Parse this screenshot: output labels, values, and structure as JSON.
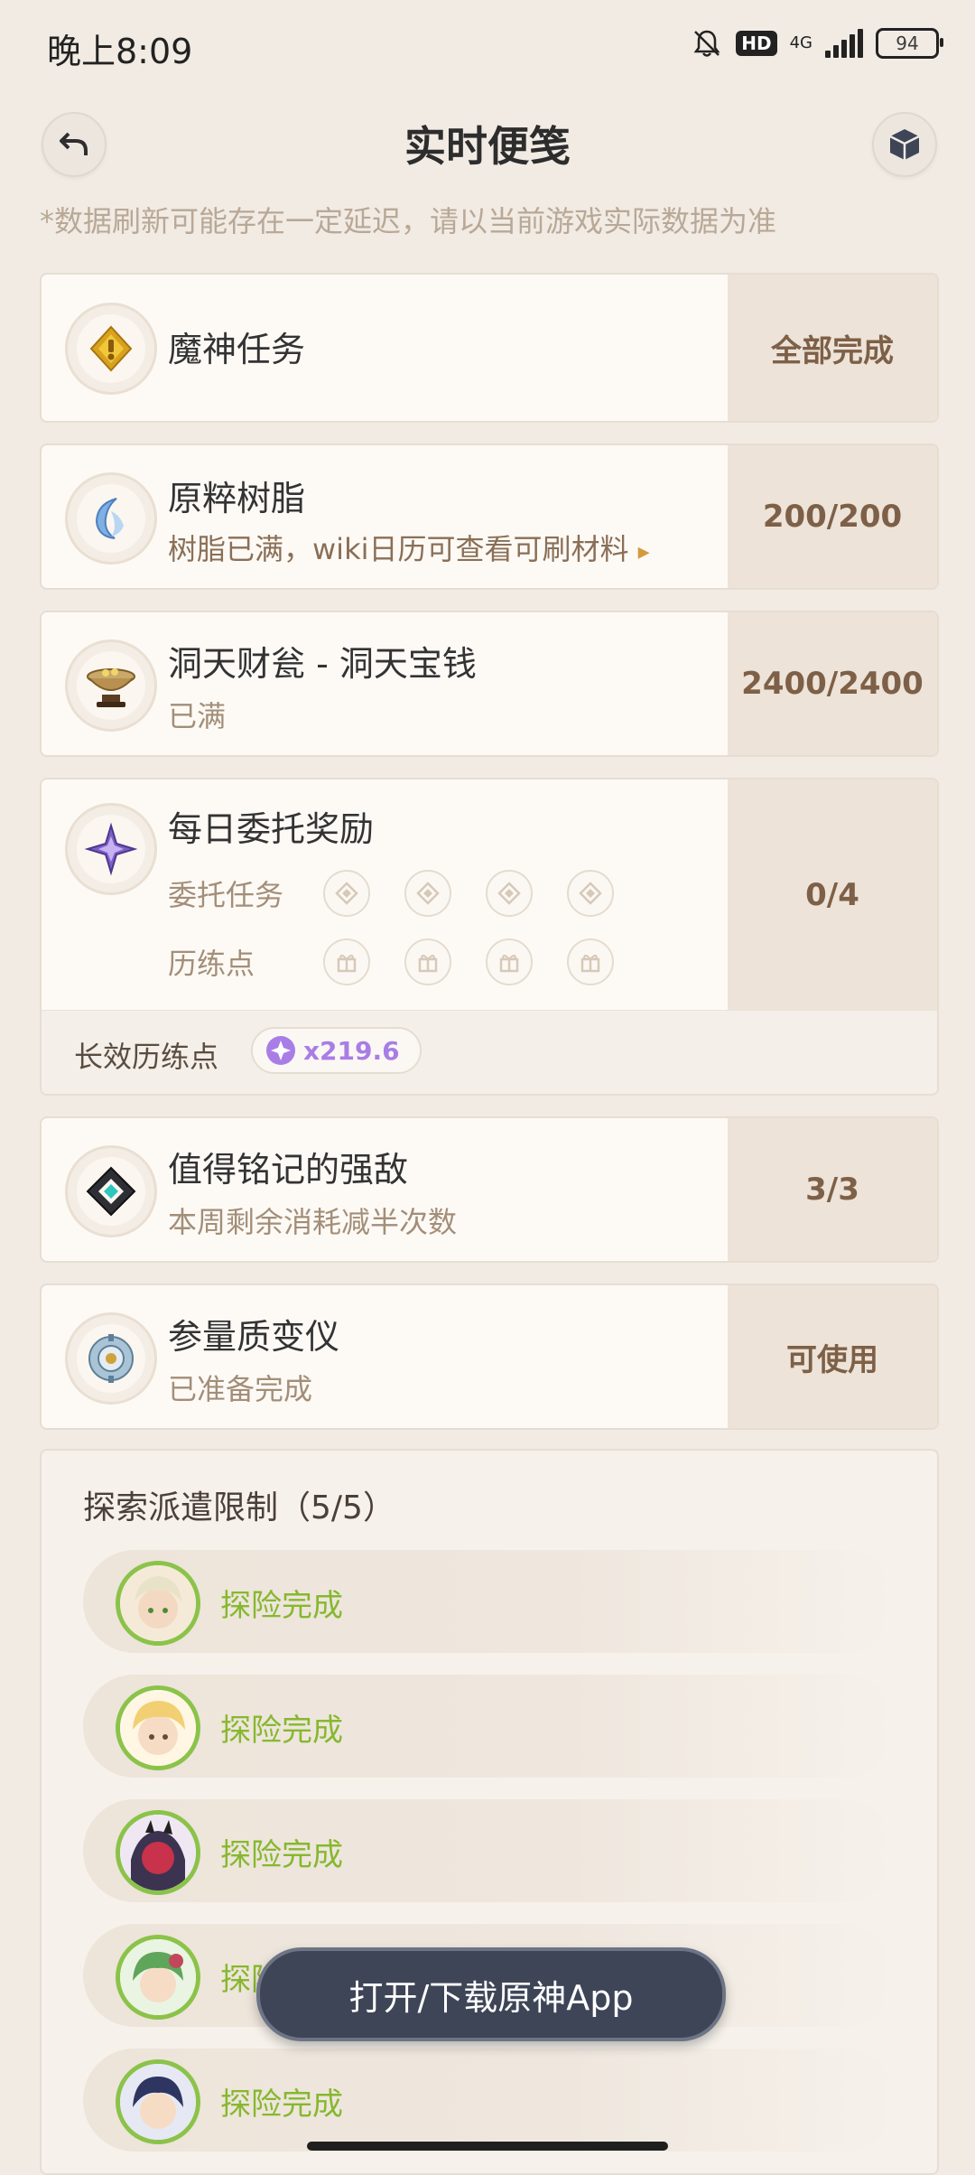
{
  "status_bar": {
    "time": "晚上8:09",
    "hd": "HD",
    "network": "4G",
    "battery": "94"
  },
  "header": {
    "title": "实时便笺"
  },
  "note": "*数据刷新可能存在一定延迟，请以当前游戏实际数据为准",
  "cards": {
    "archon": {
      "title": "魔神任务",
      "value": "全部完成"
    },
    "resin": {
      "title": "原粹树脂",
      "subtitle": "树脂已满，wiki日历可查看可刷材料",
      "arrow": "▸",
      "value": "200/200"
    },
    "realm": {
      "title": "洞天财瓮 - 洞天宝钱",
      "subtitle": "已满",
      "value": "2400/2400"
    },
    "daily": {
      "title": "每日委托奖励",
      "value": "0/4",
      "row1_label": "委托任务",
      "row2_label": "历练点",
      "bottom_label": "长效历练点",
      "bottom_value": "x219.6"
    },
    "weekly": {
      "title": "值得铭记的强敌",
      "subtitle": "本周剩余消耗减半次数",
      "value": "3/3"
    },
    "transformer": {
      "title": "参量质变仪",
      "subtitle": "已准备完成",
      "value": "可使用"
    }
  },
  "exploration": {
    "title": "探索派遣限制（5/5）",
    "items": [
      {
        "status": "探险完成"
      },
      {
        "status": "探险完成"
      },
      {
        "status": "探险完成"
      },
      {
        "status": "探险完成"
      },
      {
        "status": "探险完成"
      }
    ]
  },
  "download_button": "打开/下载原神App",
  "colors": {
    "accent_green": "#86b82f",
    "value_brown": "#7d6047",
    "purple": "#a97de6"
  }
}
